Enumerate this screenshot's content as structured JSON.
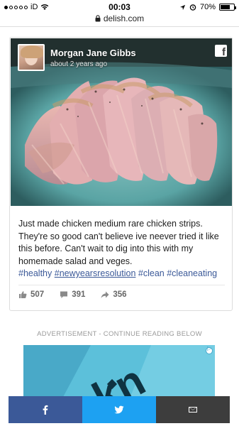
{
  "status_bar": {
    "carrier": "iD",
    "time": "00:03",
    "battery": "70%",
    "battery_level": 0.7
  },
  "browser": {
    "domain": "delish.com"
  },
  "post": {
    "author_name": "Morgan Jane Gibbs",
    "posted_time": "about 2 years ago",
    "caption": "Just made chicken medium rare chicken strips. They're so good can't believe ive neever tried it like this before. Can't wait to dig into this with my homemade salad and veges.",
    "hashtags": [
      "#healthy",
      "#newyearsresolution",
      "#clean",
      "#cleaneating"
    ],
    "likes": "507",
    "comments": "391",
    "shares": "356"
  },
  "ad": {
    "label": "ADVERTISEMENT - CONTINUE READING BELOW",
    "graphic_text": "kn"
  },
  "share_bar": {
    "facebook_icon": "facebook-icon",
    "twitter_icon": "twitter-icon",
    "email_icon": "email-icon"
  },
  "colors": {
    "facebook": "#3b5998",
    "twitter": "#1da1f2",
    "email": "#3d3d3d",
    "hashtag": "#3b5998"
  }
}
